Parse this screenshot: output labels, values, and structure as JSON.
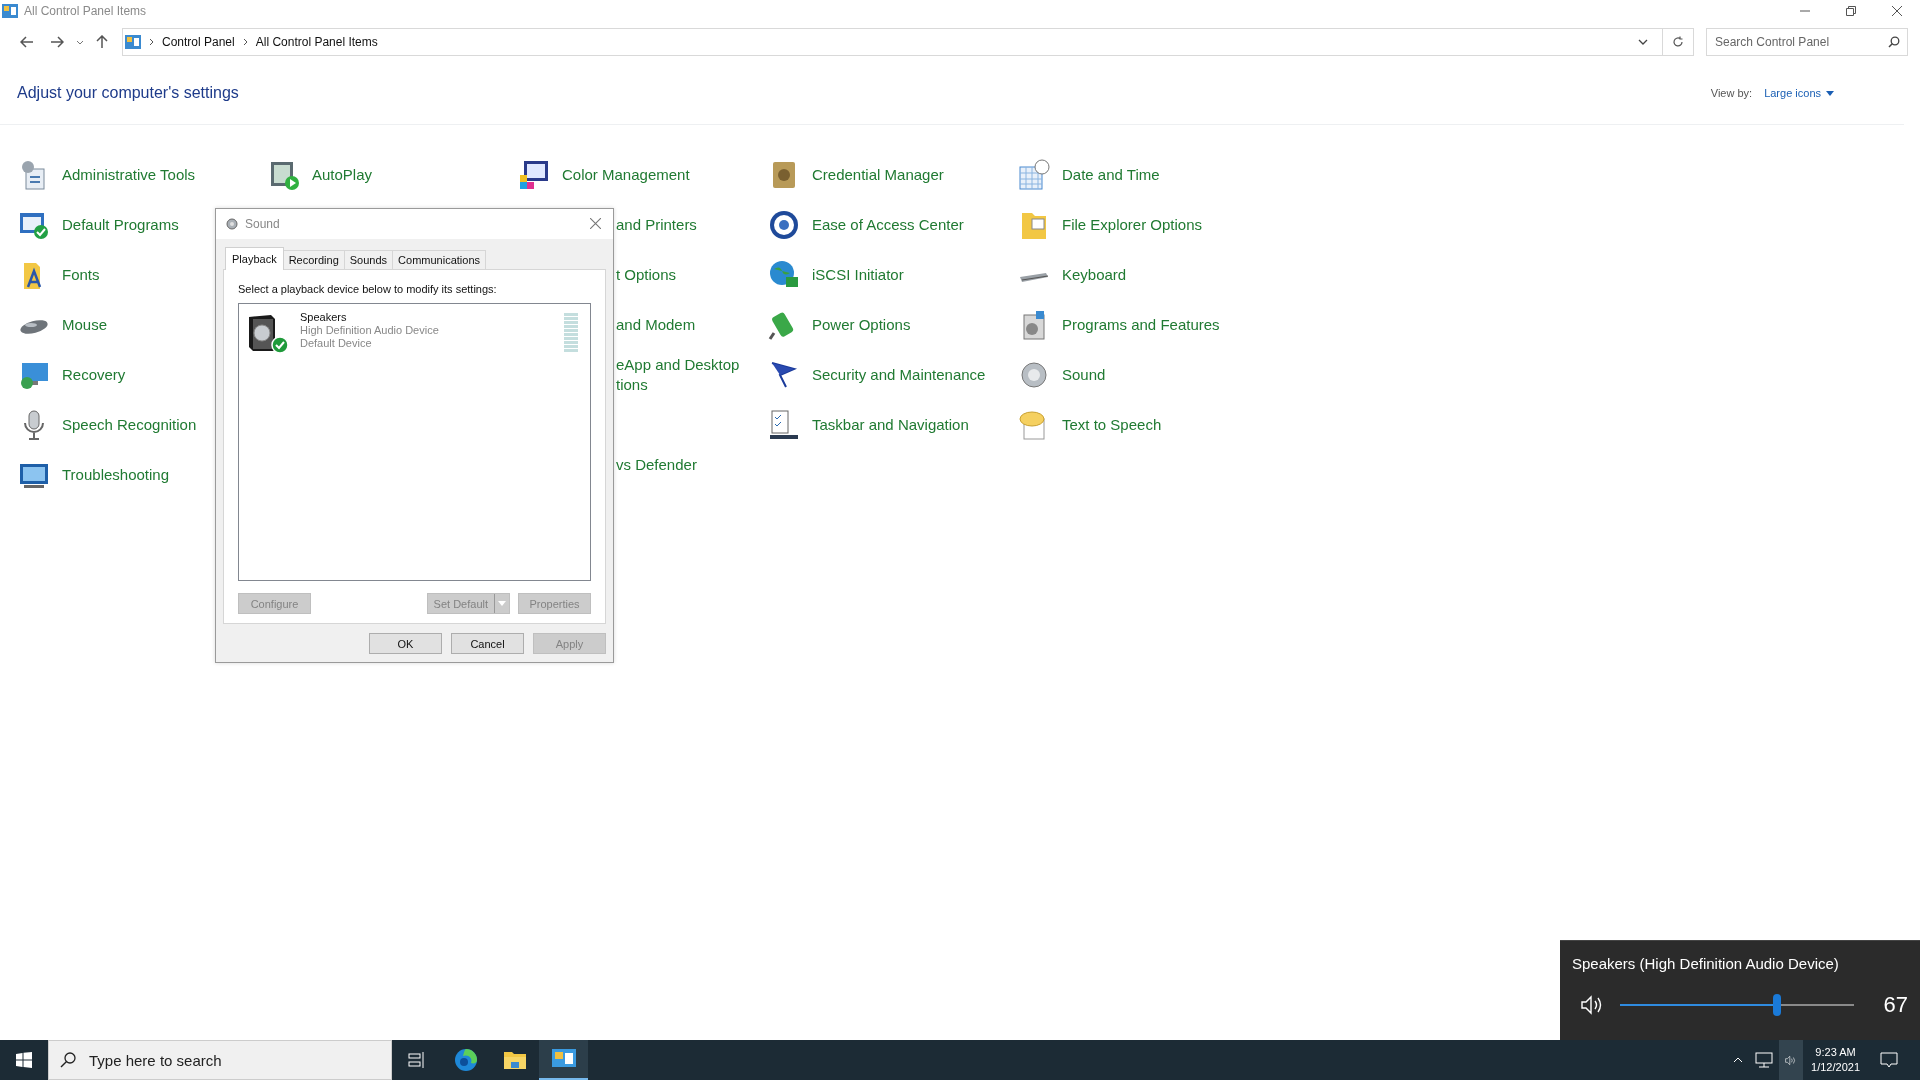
{
  "window": {
    "title": "All Control Panel Items"
  },
  "address": {
    "crumbs": [
      "Control Panel",
      "All Control Panel Items"
    ],
    "search_placeholder": "Search Control Panel"
  },
  "header": {
    "title": "Adjust your computer's settings",
    "view_by_label": "View by:",
    "view_by_value": "Large icons"
  },
  "columns": [
    {
      "items": [
        {
          "kind": "full",
          "lines": [
            "Administrative Tools"
          ]
        },
        {
          "kind": "full",
          "lines": [
            "Default Programs"
          ]
        },
        {
          "kind": "full",
          "lines": [
            "Fonts"
          ]
        },
        {
          "kind": "full",
          "lines": [
            "Mouse"
          ]
        },
        {
          "kind": "full",
          "lines": [
            "Recovery"
          ]
        },
        {
          "kind": "full",
          "lines": [
            "Speech Recognition"
          ]
        },
        {
          "kind": "full",
          "lines": [
            "Troubleshooting"
          ]
        }
      ]
    },
    {
      "items": [
        {
          "kind": "full",
          "lines": [
            "AutoPlay"
          ]
        }
      ]
    },
    {
      "items": [
        {
          "kind": "full",
          "lines": [
            "Color Management"
          ]
        },
        {
          "kind": "clipped",
          "lines": [
            "and Printers"
          ]
        },
        {
          "kind": "clipped",
          "lines": [
            "t Options"
          ]
        },
        {
          "kind": "clipped",
          "lines": [
            "and Modem"
          ]
        },
        {
          "kind": "clipped",
          "lines": [
            "eApp and Desktop",
            "tions"
          ]
        },
        {
          "kind": "clipped",
          "lines": [
            "vs Defender"
          ]
        }
      ]
    },
    {
      "items": [
        {
          "kind": "full",
          "lines": [
            "Credential Manager"
          ]
        },
        {
          "kind": "full",
          "lines": [
            "Ease of Access Center"
          ]
        },
        {
          "kind": "full",
          "lines": [
            "iSCSI Initiator"
          ]
        },
        {
          "kind": "full",
          "lines": [
            "Power Options"
          ]
        },
        {
          "kind": "full",
          "lines": [
            "Security and Maintenance"
          ]
        },
        {
          "kind": "full",
          "lines": [
            "Taskbar and Navigation"
          ]
        }
      ]
    },
    {
      "items": [
        {
          "kind": "full",
          "lines": [
            "Date and Time"
          ]
        },
        {
          "kind": "full",
          "lines": [
            "File Explorer Options"
          ]
        },
        {
          "kind": "full",
          "lines": [
            "Keyboard"
          ]
        },
        {
          "kind": "full",
          "lines": [
            "Programs and Features"
          ]
        },
        {
          "kind": "full",
          "lines": [
            "Sound"
          ]
        },
        {
          "kind": "full",
          "lines": [
            "Text to Speech"
          ]
        }
      ]
    }
  ],
  "dialog": {
    "title": "Sound",
    "tabs": [
      {
        "label": "Playback",
        "selected": true
      },
      {
        "label": "Recording",
        "selected": false
      },
      {
        "label": "Sounds",
        "selected": false
      },
      {
        "label": "Communications",
        "selected": false
      }
    ],
    "instruction": "Select a playback device below to modify its settings:",
    "devices": [
      {
        "name": "Speakers",
        "description": "High Definition Audio Device",
        "status": "Default Device",
        "selected": false
      }
    ],
    "device_buttons": [
      {
        "label": "Configure",
        "disabled": true
      },
      {
        "label": "Set Default",
        "disabled": true
      },
      {
        "label": "Properties",
        "disabled": true
      }
    ],
    "buttons": [
      {
        "label": "OK",
        "disabled": false
      },
      {
        "label": "Cancel",
        "disabled": false
      },
      {
        "label": "Apply",
        "disabled": true
      }
    ]
  },
  "volume_flyout": {
    "device": "Speakers (High Definition Audio Device)",
    "level": 0.67,
    "reading": "67"
  },
  "taskbar": {
    "search_placeholder": "Type here to search",
    "apps": [
      {
        "kind": "taskview",
        "active": false
      },
      {
        "kind": "browser",
        "active": false
      },
      {
        "kind": "folder",
        "active": false
      },
      {
        "kind": "controlpanel",
        "active": true
      }
    ],
    "volume_selected": true,
    "time": "9:23 AM",
    "date": "1/12/2021"
  }
}
